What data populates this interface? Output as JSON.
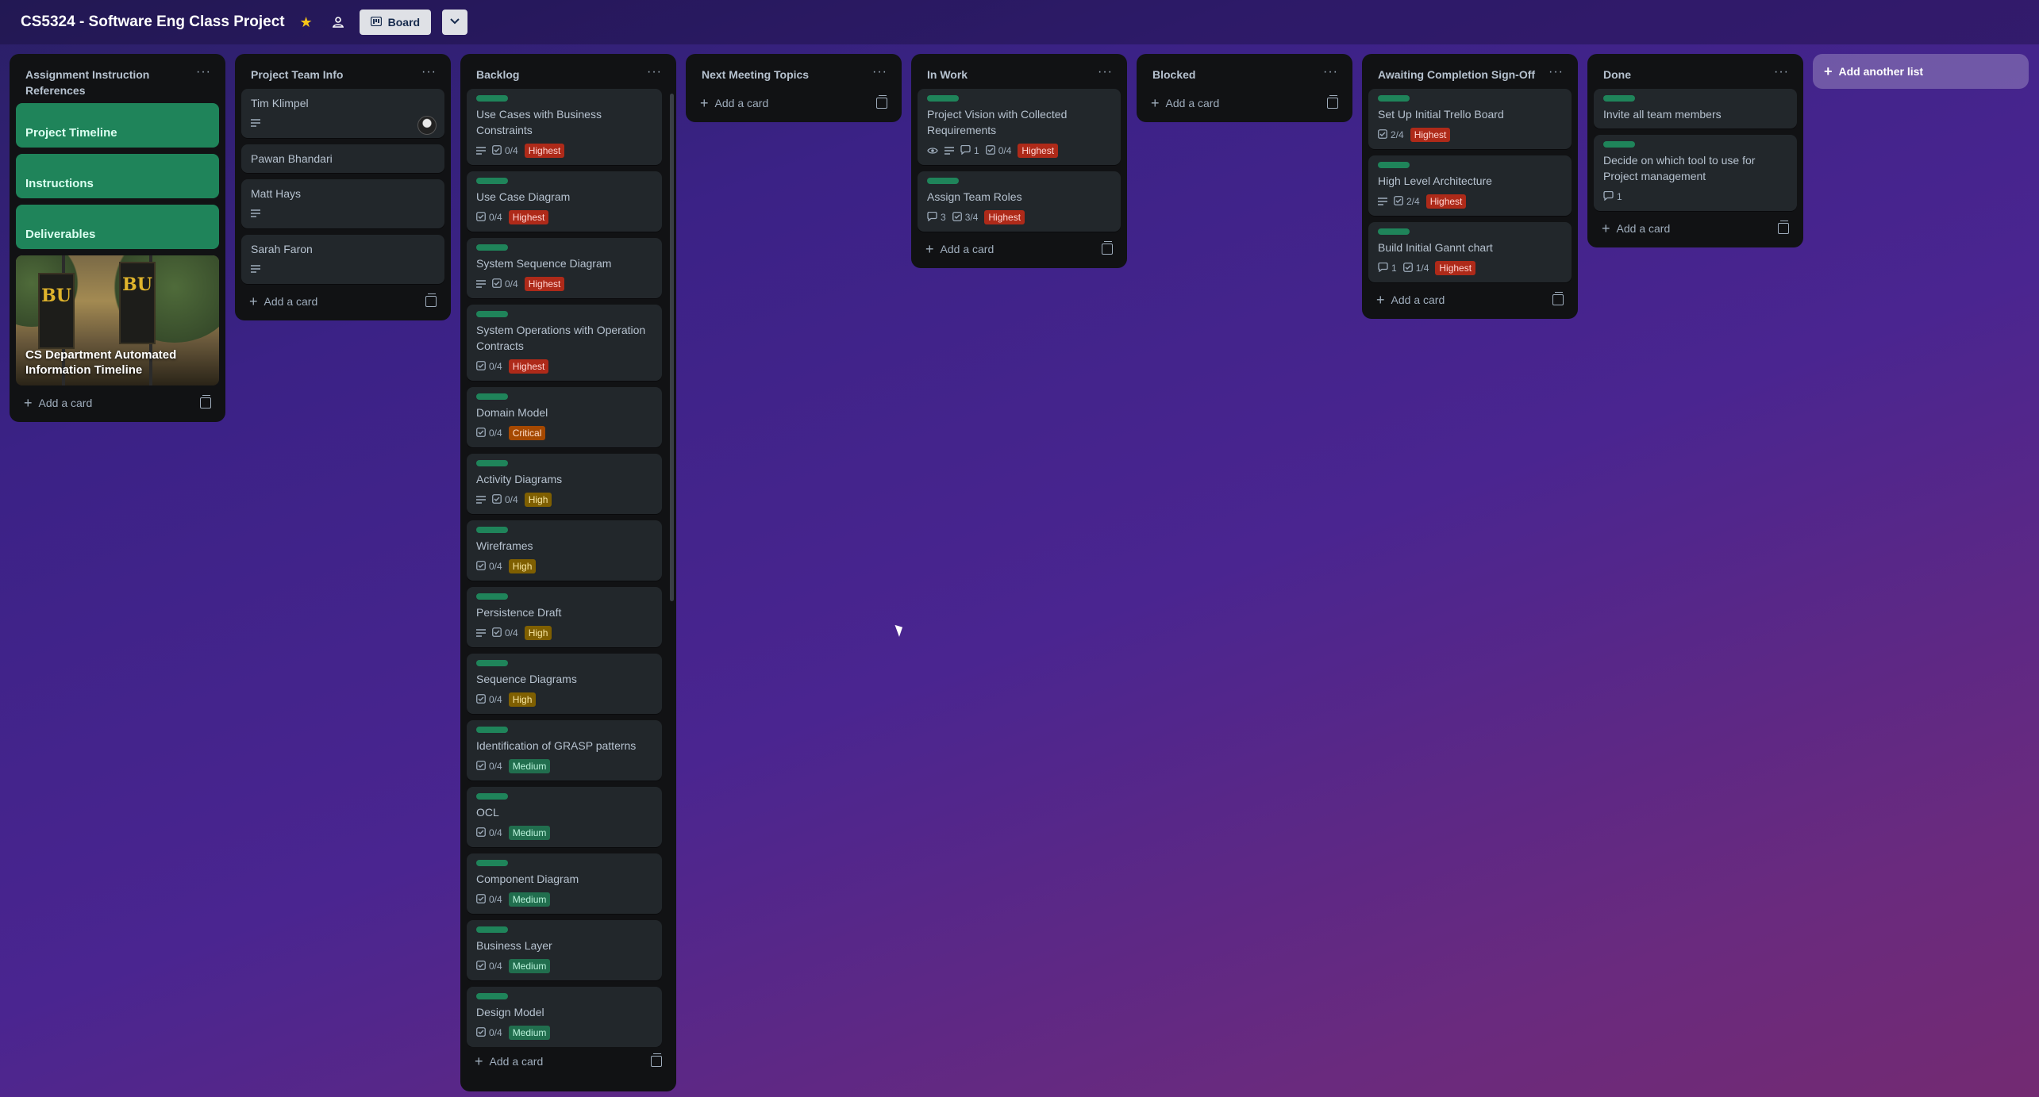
{
  "board": {
    "title": "CS5324 - Software Eng Class Project",
    "view_label": "Board",
    "add_list_label": "Add another list"
  },
  "icons": {
    "star": "star-icon",
    "visibility": "workspace-visible-icon",
    "board_view": "board-icon",
    "chevron": "chevron-down-icon"
  },
  "common": {
    "add_card": "Add a card",
    "menu": "···"
  },
  "lists": {
    "assign": {
      "title": "Assignment Instruction References",
      "cards": [
        {
          "title": "Project Timeline"
        },
        {
          "title": "Instructions"
        },
        {
          "title": "Deliverables"
        },
        {
          "title": "CS Department Automated Information Timeline",
          "cover_text": "BU"
        }
      ]
    },
    "team": {
      "title": "Project Team Info",
      "cards": [
        {
          "title": "Tim Klimpel"
        },
        {
          "title": "Pawan Bhandari"
        },
        {
          "title": "Matt Hays"
        },
        {
          "title": "Sarah Faron"
        }
      ]
    },
    "backlog": {
      "title": "Backlog",
      "cards": [
        {
          "title": "Use Cases with Business Constraints",
          "checklist": "0/4",
          "priority": "Highest"
        },
        {
          "title": "Use Case Diagram",
          "checklist": "0/4",
          "priority": "Highest"
        },
        {
          "title": "System Sequence Diagram",
          "checklist": "0/4",
          "priority": "Highest"
        },
        {
          "title": "System Operations with Operation Contracts",
          "checklist": "0/4",
          "priority": "Highest"
        },
        {
          "title": "Domain Model",
          "checklist": "0/4",
          "priority": "Critical"
        },
        {
          "title": "Activity Diagrams",
          "checklist": "0/4",
          "priority": "High"
        },
        {
          "title": "Wireframes",
          "checklist": "0/4",
          "priority": "High"
        },
        {
          "title": "Persistence Draft",
          "checklist": "0/4",
          "priority": "High"
        },
        {
          "title": "Sequence Diagrams",
          "checklist": "0/4",
          "priority": "High"
        },
        {
          "title": "Identification of GRASP patterns",
          "checklist": "0/4",
          "priority": "Medium"
        },
        {
          "title": "OCL",
          "checklist": "0/4",
          "priority": "Medium"
        },
        {
          "title": "Component Diagram",
          "checklist": "0/4",
          "priority": "Medium"
        },
        {
          "title": "Business Layer",
          "checklist": "0/4",
          "priority": "Medium"
        },
        {
          "title": "Design Model",
          "checklist": "0/4",
          "priority": "Medium"
        }
      ]
    },
    "meeting": {
      "title": "Next Meeting Topics"
    },
    "inwork": {
      "title": "In Work",
      "cards": [
        {
          "title": "Project Vision with Collected Requirements",
          "comments": "1",
          "checklist": "0/4",
          "priority": "Highest"
        },
        {
          "title": "Assign Team Roles",
          "comments": "3",
          "checklist": "3/4",
          "priority": "Highest"
        }
      ]
    },
    "blocked": {
      "title": "Blocked"
    },
    "awaiting": {
      "title": "Awaiting Completion Sign-Off",
      "cards": [
        {
          "title": "Set Up Initial Trello Board",
          "checklist": "2/4",
          "priority": "Highest"
        },
        {
          "title": "High Level Architecture",
          "checklist": "2/4",
          "priority": "Highest"
        },
        {
          "title": "Build Initial Gannt chart",
          "comments": "1",
          "checklist": "1/4",
          "priority": "Highest"
        }
      ]
    },
    "done": {
      "title": "Done",
      "cards": [
        {
          "title": "Invite all team members"
        },
        {
          "title": "Decide on which tool to use for Project management",
          "comments": "1"
        }
      ]
    }
  },
  "colors": {
    "label_green": "#1f845a",
    "Highest": "#ae2a19",
    "Critical": "#a54800",
    "High": "#7f5f01",
    "Medium": "#216e4e"
  }
}
